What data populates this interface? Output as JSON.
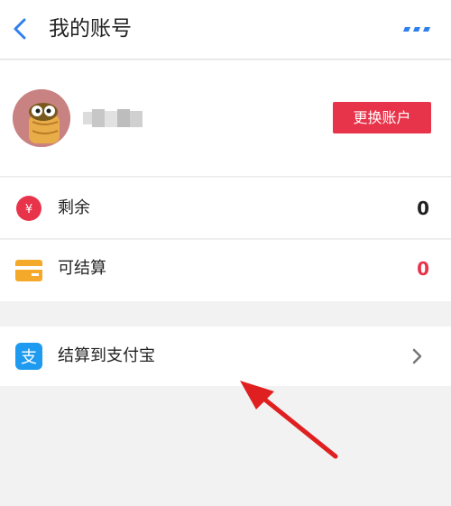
{
  "header": {
    "title": "我的账号",
    "back_icon": "chevron-left-icon",
    "more_icon": "more-dots-icon",
    "accent_color": "#2f80ed"
  },
  "profile": {
    "avatar": "avatar-cartoon-icon",
    "switch_button_label": "更换账户",
    "button_color": "#e8344b"
  },
  "account": {
    "balance": {
      "icon": "yuan-icon",
      "label": "剩余",
      "value": "0",
      "value_color": "#222222"
    },
    "settleable": {
      "icon": "card-icon",
      "label": "可结算",
      "value": "0",
      "value_color": "#e8344b"
    }
  },
  "withdraw": {
    "icon": "alipay-icon",
    "label": "结算到支付宝",
    "chevron_icon": "chevron-right-icon"
  },
  "annotation": {
    "arrow_icon": "red-arrow-icon",
    "color": "#e02020"
  }
}
